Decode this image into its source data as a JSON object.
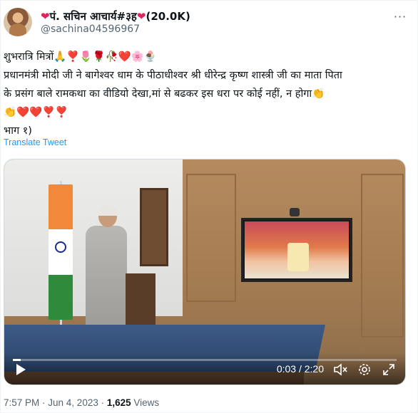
{
  "tweet": {
    "display_name": "पं. सचिन आचार्य#३ह",
    "follower_badge": "(20.0K)",
    "handle": "@sachina04596967",
    "text_line1": "शुभरात्रि मित्रों",
    "text_line1_emojis": "🙏❣️🌷🌹🥀❤️🌸🍨",
    "text_line2": "प्रधानमंत्री मोदी जी ने बागेश्वर धाम के पीठाधीश्वर श्री धीरेन्द्र कृष्ण शास्त्री जी का माता पिता",
    "text_line3": "के प्रसंग बाले रामकथा का वीडियो देखा,मां से बढकर इस धरा पर कोई नहीं, न होगा",
    "text_line3_emoji": "👏",
    "text_line4_emojis": "👏❤️❤️❣️❣️",
    "text_line5": "भाग १)",
    "translate_label": "Translate Tweet",
    "time": "7:57 PM",
    "date": "Jun 4, 2023",
    "views_count": "1,625",
    "views_label": "Views"
  },
  "video": {
    "time_display": "0:03 / 2:20",
    "progress_fraction": 0.021,
    "play_icon": "play-icon",
    "mute_icon": "volume-muted-icon",
    "settings_icon": "gear-icon",
    "fullscreen_icon": "expand-icon"
  },
  "colors": {
    "link": "#1d9bf0",
    "heart": "#e0245e",
    "secondary_text": "#536471"
  }
}
